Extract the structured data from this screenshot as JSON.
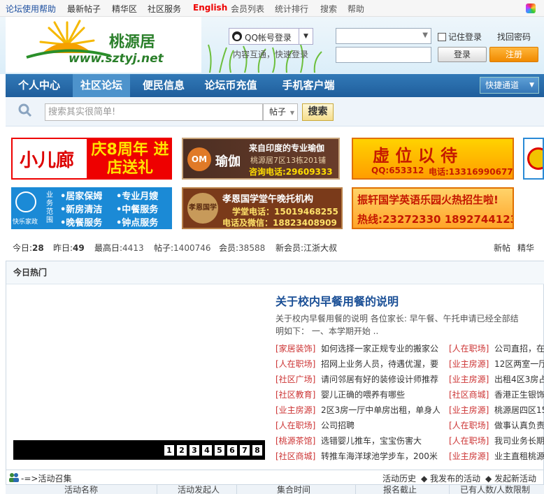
{
  "topbar": {
    "items": [
      "论坛使用帮助",
      "最新帖子",
      "精华区",
      "社区服务",
      "English",
      "会员列表",
      "统计排行",
      "搜索",
      "帮助"
    ]
  },
  "logo": {
    "name": "桃源居",
    "url": "www.sztyj.net"
  },
  "qq": {
    "login_label": "QQ帐号登录",
    "sub": "内容互通，快速登录"
  },
  "login": {
    "remember": "记住登录",
    "forgot": "找回密码",
    "login_btn": "登录",
    "register_btn": "注册"
  },
  "nav": {
    "items": [
      "个人中心",
      "社区论坛",
      "便民信息",
      "论坛币充值",
      "手机客户端"
    ],
    "active_index": 1,
    "quick": "快捷通道"
  },
  "search": {
    "placeholder": "搜索其实很简单!",
    "type": "帖子",
    "button": "搜索"
  },
  "ads": {
    "a1_left": "小儿廊",
    "a1_right": "庆8周年 进店送礼",
    "a2_title": "来自印度的专业瑜伽",
    "a2_name": "瑜伽",
    "a2_addr": "桃源居7区13栋201铺",
    "a2_tel": "咨询电话:29609333",
    "a2_logo": "OM",
    "a3_title": "虚 位 以 待",
    "a3_qq": "QQ:653312",
    "a3_tel": "电话:13316990677",
    "a5_brand": "快乐家政",
    "a5_lines": [
      "业务范围",
      "•居家保姆",
      "•新房清洁",
      "•晚餐服务",
      "•专业月嫂",
      "•中餐服务",
      "•钟点服务"
    ],
    "a6_title": "孝恩国学堂午晚托机构",
    "a6_tel1": "学堂电话：15019468255",
    "a6_tel2": "电话及微信：18823408909",
    "a6_logo": "孝恩国学",
    "a7_title": "振轩国学英语乐园火热招生啦!",
    "a7_tel": "热线:23272330  18927441230"
  },
  "stats": {
    "today_label": "今日:",
    "today": "28",
    "yesterday_label": "昨日:",
    "yesterday": "49",
    "max_label": "最高日:",
    "max": "4413",
    "posts_label": "帖子:",
    "posts": "1400746",
    "members_label": "会员:",
    "members": "38588",
    "newmember_label": "新会员:",
    "newmember": "江浙大叔",
    "new_posts": "新帖",
    "digest": "精华"
  },
  "hot": {
    "title": "今日热门",
    "pages": [
      "1",
      "2",
      "3",
      "4",
      "5",
      "6",
      "7",
      "8"
    ],
    "headline": "关于校内早餐用餐的说明",
    "summary": [
      "关于校内早餐用餐的说明  各位家长:      早午餐、午托申请已经全部结",
      "明如下：        一、本学期开始  .."
    ],
    "left": [
      {
        "tag": "[家居装饰]",
        "title": "如何选择一家正规专业的搬家公"
      },
      {
        "tag": "[人在职场]",
        "title": "招网上业务人员，待遇优渥，要"
      },
      {
        "tag": "[社区广场]",
        "title": "请问邻居有好的装修设计师推荐"
      },
      {
        "tag": "[社区教育]",
        "title": "婴儿正确的喂养有哪些"
      },
      {
        "tag": "[业主房源]",
        "title": "2区3房一厅中单房出租，单身人"
      },
      {
        "tag": "[人在职场]",
        "title": "公司招聘"
      },
      {
        "tag": "[桃源茶馆]",
        "title": "选错婴儿推车，宝宝伤害大"
      },
      {
        "tag": "[社区商城]",
        "title": "转推车海洋球池学步车，200米"
      }
    ],
    "right": [
      {
        "tag": "[人在职场]",
        "title": "公司直招，在"
      },
      {
        "tag": "[业主房源]",
        "title": "12区两室一厅"
      },
      {
        "tag": "[业主房源]",
        "title": "出租4区3房占"
      },
      {
        "tag": "[社区商城]",
        "title": "香港正生银饰"
      },
      {
        "tag": "[业主房源]",
        "title": "桃源居四区15"
      },
      {
        "tag": "[人在职场]",
        "title": "做事认真负责"
      },
      {
        "tag": "[人在职场]",
        "title": "我司业务长期"
      },
      {
        "tag": "[业主房源]",
        "title": "业主直租桃源"
      }
    ]
  },
  "activity": {
    "title": "-=>活动召集",
    "history": "活动历史",
    "mine": "◆ 我发布的活动",
    "create": "◆ 发起新活动",
    "columns": [
      "活动名称",
      "活动发起人",
      "集合时间",
      "报名截止",
      "已有人数/人数限制"
    ]
  }
}
